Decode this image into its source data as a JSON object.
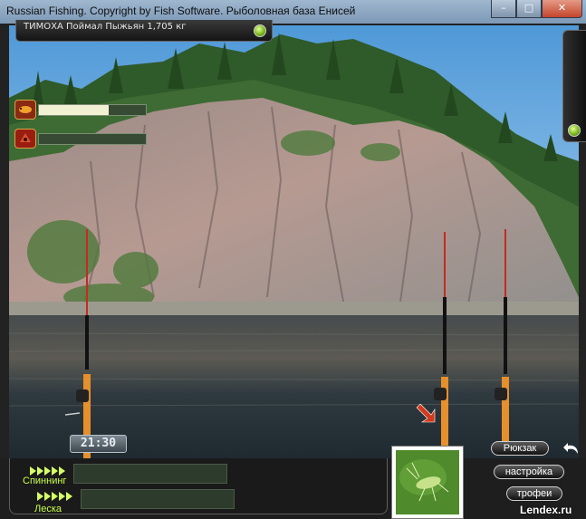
{
  "window": {
    "title": "Russian Fishing. Copyright by Fish Software. Рыболовная база Енисей"
  },
  "message": {
    "text": "ТИМОХА Поймал Пыжьян 1,705 кг"
  },
  "status_bars": [
    {
      "icon": "bait-worm-icon",
      "fill_fraction": 0.65
    },
    {
      "icon": "groundbait-icon",
      "fill_fraction": 0.0
    }
  ],
  "clock": {
    "time": "21:30"
  },
  "gauges": [
    {
      "label": "Спиннинг",
      "fill_fraction": 0.0
    },
    {
      "label": "Леска",
      "fill_fraction": 0.0
    }
  ],
  "menu": {
    "backpack": "Рюкзак",
    "settings": "настройка",
    "trophies": "трофеи"
  },
  "watermark": "Lendex.ru",
  "colors": {
    "gauge_green": "#c9ff4a",
    "bar_fill": "#f2f0d3",
    "rod_orange": "#e58f2d"
  }
}
